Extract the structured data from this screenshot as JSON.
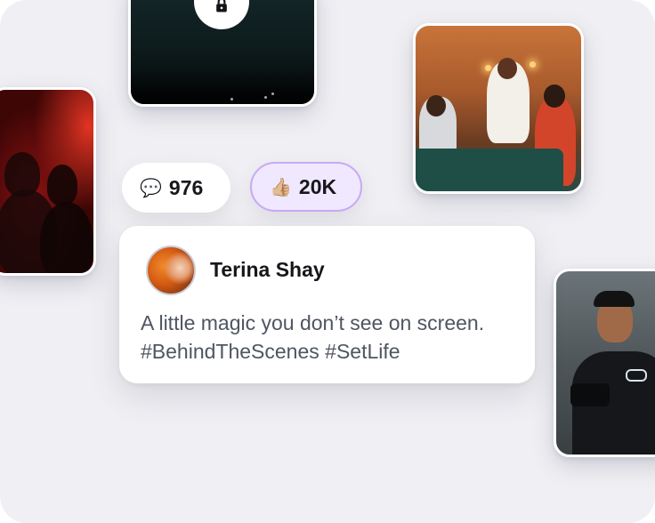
{
  "post": {
    "author": "Terina Shay",
    "text": "A little magic you don’t see on screen. #BehindTheScenes #SetLife"
  },
  "stats": {
    "comments": {
      "emoji": "💬",
      "count": "976"
    },
    "likes": {
      "emoji": "👍🏼",
      "count": "20K"
    }
  },
  "media": {
    "locked_video": {
      "icon": "lock-icon"
    }
  },
  "colors": {
    "background": "#f0f0f4",
    "likes_pill_bg": "#f0e8fe",
    "likes_pill_border": "#c7a9f7",
    "post_text": "#4f5562",
    "author_text": "#16161b"
  }
}
